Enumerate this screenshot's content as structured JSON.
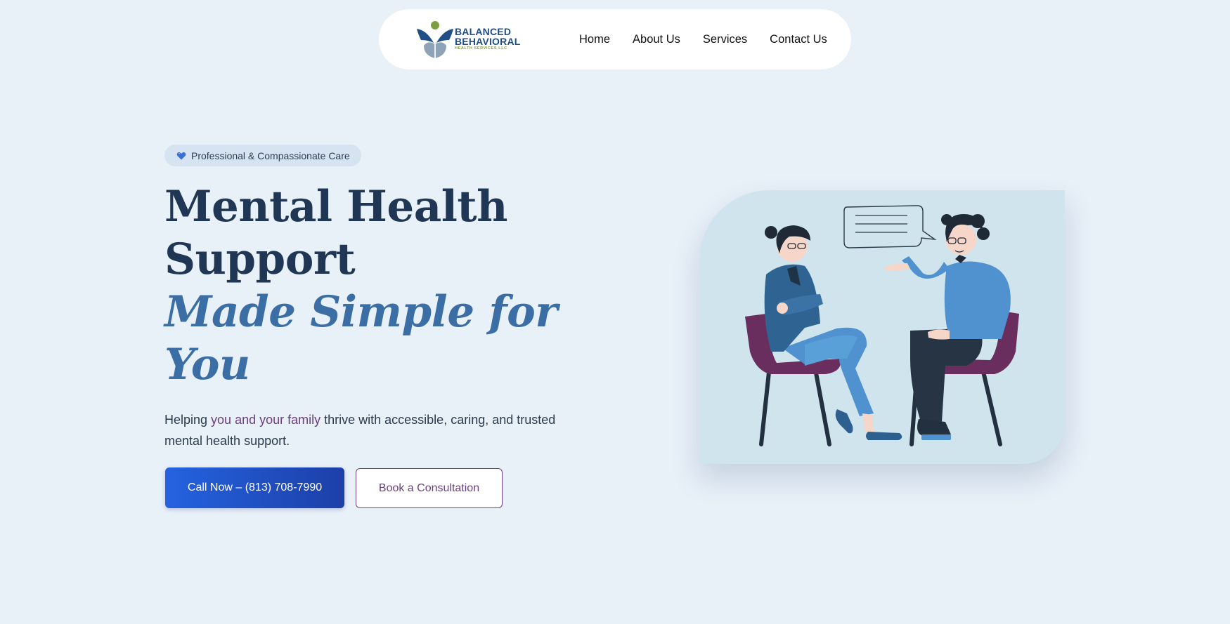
{
  "nav": {
    "logo": {
      "line1": "BALANCED",
      "line2": "BEHAVIORAL",
      "line3": "HEALTH SERVICES LLC"
    },
    "links": [
      "Home",
      "About Us",
      "Services",
      "Contact Us"
    ]
  },
  "hero": {
    "badge_icon": "heart-icon",
    "badge_text": "Professional & Compassionate Care",
    "headline_line1": "Mental Health",
    "headline_line2": "Support",
    "headline_accent_line1": "Made Simple for",
    "headline_accent_line2": "You",
    "sub_part1": "Helping ",
    "sub_highlight": "you and your family",
    "sub_part2": " thrive with accessible, caring, and trusted mental health support.",
    "primary_button": "Call Now – (813) 708-7990",
    "secondary_button": "Book a Consultation"
  },
  "colors": {
    "background": "#e8f0f8",
    "heading": "#1f3654",
    "accent": "#3b6ea5",
    "highlight": "#6b3f7e",
    "primary_button": "#2463e0",
    "illustration_bg": "#cfe4ec"
  }
}
